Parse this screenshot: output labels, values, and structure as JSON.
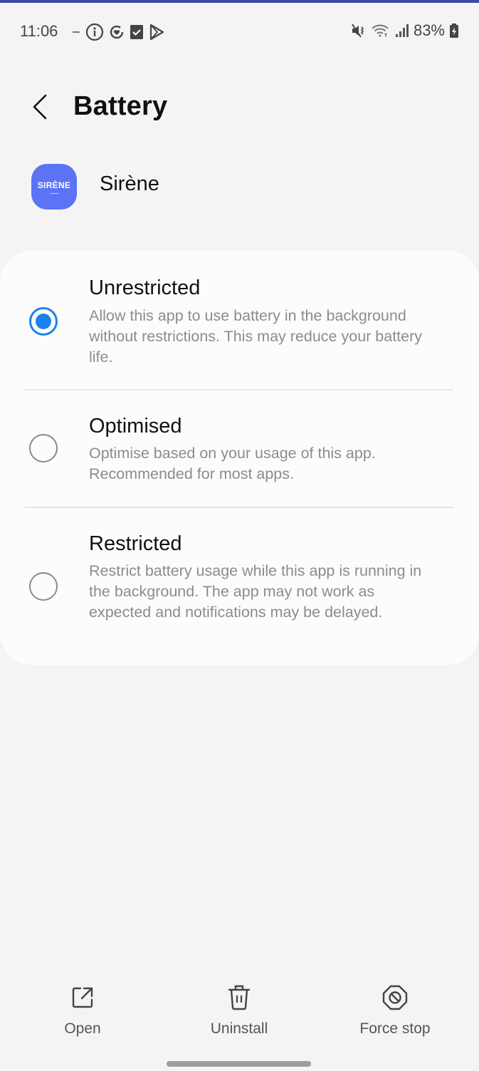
{
  "status_bar": {
    "time": "11:06",
    "left_icons": [
      "dash-icon",
      "info-icon",
      "sync-heart-icon",
      "checkbox-icon",
      "play-store-icon"
    ],
    "right_icons": [
      "mute-vibrate-icon",
      "wifi-icon",
      "signal-icon"
    ],
    "battery_percent": "83%",
    "battery_charging": true
  },
  "header": {
    "title": "Battery",
    "back_icon": "chevron-left-icon"
  },
  "app": {
    "name": "Sirène",
    "icon_text": "SIRÈNE",
    "icon_color": "#5b73f5"
  },
  "options": [
    {
      "title": "Unrestricted",
      "description": "Allow this app to use battery in the background without restrictions. This may reduce your battery life.",
      "selected": true
    },
    {
      "title": "Optimised",
      "description": "Optimise based on your usage of this app. Recommended for most apps.",
      "selected": false
    },
    {
      "title": "Restricted",
      "description": "Restrict battery usage while this app is running in the background. The app may not work as expected and notifications may be delayed.",
      "selected": false
    }
  ],
  "actions": [
    {
      "label": "Open",
      "icon": "open-external-icon"
    },
    {
      "label": "Uninstall",
      "icon": "trash-icon"
    },
    {
      "label": "Force stop",
      "icon": "stop-octagon-icon"
    }
  ],
  "colors": {
    "accent": "#1a82f0",
    "background": "#f4f4f4",
    "card": "#fcfcfc"
  }
}
